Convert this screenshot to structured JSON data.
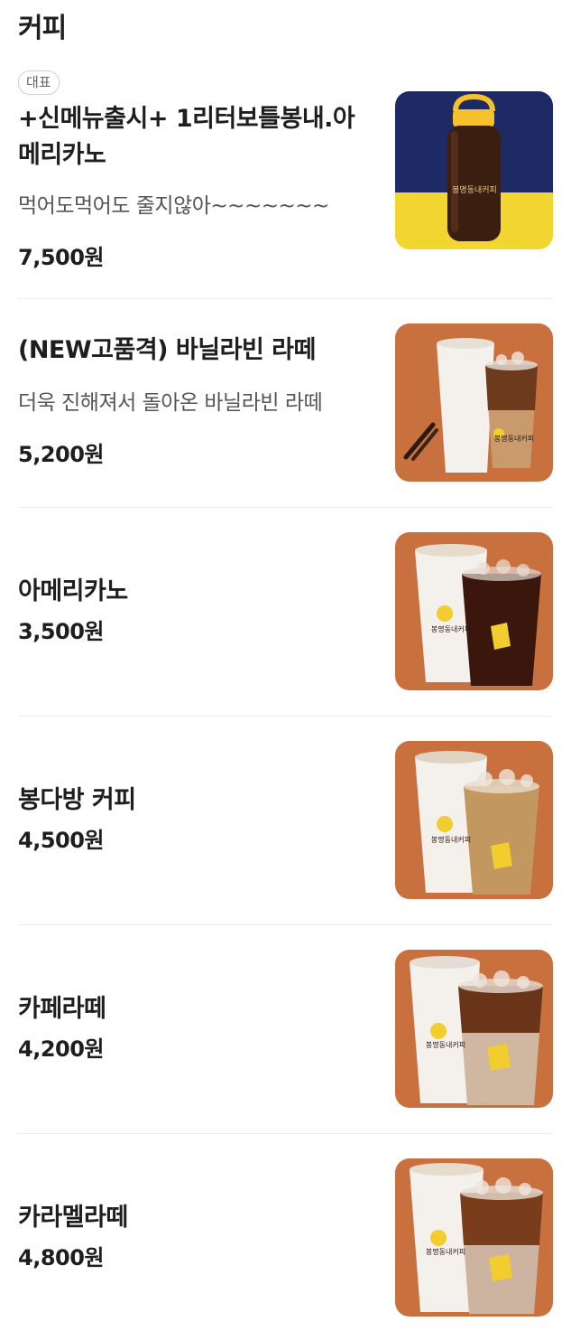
{
  "section": {
    "title": "커피"
  },
  "items": [
    {
      "badge": "대표",
      "name": "+신메뉴출시+ 1리터보틀봉내.아메리카노",
      "description": "먹어도먹어도 줄지않아~~~~~~~",
      "price": "7,500원",
      "image_icon": "bottle-coffee-photo",
      "bottle_label": "봉명동내커피"
    },
    {
      "name": "(NEW고품격) 바닐라빈 라떼",
      "description": "더욱 진해져서 돌아온 바닐라빈 라떼",
      "price": "5,200원",
      "image_icon": "vanilla-latte-photo",
      "cup_label": "봉명동내커피"
    },
    {
      "name": "아메리카노",
      "price": "3,500원",
      "image_icon": "americano-photo",
      "cup_label": "봉명동내커피"
    },
    {
      "name": "봉다방 커피",
      "price": "4,500원",
      "image_icon": "bongdabang-coffee-photo",
      "cup_label": "봉명동내커피"
    },
    {
      "name": "카페라떼",
      "price": "4,200원",
      "image_icon": "cafe-latte-photo",
      "cup_label": "봉명동내커피"
    },
    {
      "name": "카라멜라떼",
      "price": "4,800원",
      "image_icon": "caramel-latte-photo",
      "cup_label": "봉명동내커피"
    }
  ],
  "colors": {
    "photo_background": "#c9703f",
    "bottle_background_top": "#1d2a66",
    "bottle_background_bottom": "#f2d531",
    "cap_yellow": "#f5c22c",
    "logo_yellow": "#f2cd2e"
  }
}
